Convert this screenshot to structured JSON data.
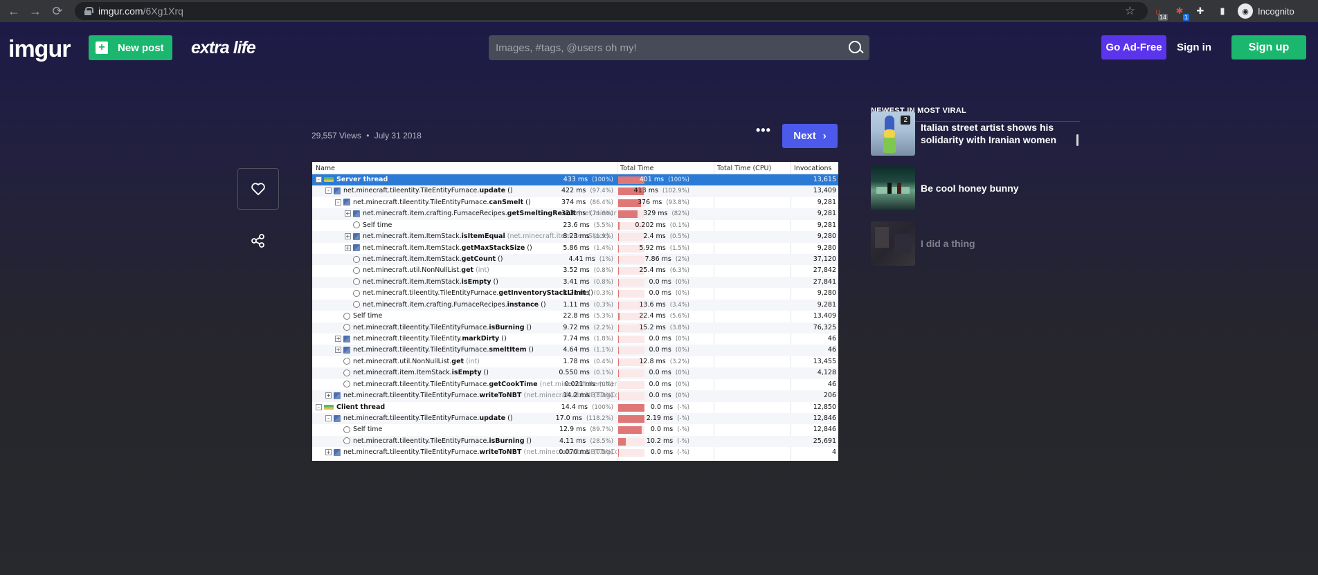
{
  "browser": {
    "url_host": "imgur.com",
    "url_path": "/6Xg1Xrq",
    "ext1_badge": "14",
    "ext2_badge": "1",
    "incognito_label": "Incognito"
  },
  "header": {
    "logo": "imgur",
    "new_post": "New post",
    "extra_life": "extra life",
    "search_placeholder": "Images, #tags, @users oh my!",
    "go_ad_free": "Go Ad-Free",
    "sign_in": "Sign in",
    "sign_up": "Sign up"
  },
  "post": {
    "views": "29,557 Views",
    "separator": "•",
    "date": "July 31 2018",
    "more": "•••",
    "next": "Next"
  },
  "profiler": {
    "headers": [
      "Name",
      "Total Time",
      "Total Time (CPU)",
      "Invocations"
    ],
    "rows": [
      {
        "prefix": "",
        "bold": "Server thread",
        "suffix": "",
        "hint": "",
        "t": "433 ms",
        "tp": "(100%)",
        "cpu": "401 ms",
        "cp": "(100%)",
        "inv": "13,615",
        "bar": 1.0
      },
      {
        "prefix": "net.minecraft.tileentity.TileEntityFurnace.",
        "bold": "update",
        "suffix": " ()",
        "hint": "",
        "t": "422 ms",
        "tp": "(97.4%)",
        "cpu": "413 ms",
        "cp": "(102.9%)",
        "inv": "13,409",
        "bar": 0.974
      },
      {
        "prefix": "net.minecraft.tileentity.TileEntityFurnace.",
        "bold": "canSmelt",
        "suffix": " ()",
        "hint": "",
        "t": "374 ms",
        "tp": "(86.4%)",
        "cpu": "376 ms",
        "cp": "(93.8%)",
        "inv": "9,281",
        "bar": 0.864
      },
      {
        "prefix": "net.minecraft.item.crafting.FurnaceRecipes.",
        "bold": "getSmeltingResult",
        "suffix": " ",
        "hint": "(net.minecra",
        "t": "323 ms",
        "tp": "(74.6%)",
        "cpu": "329 ms",
        "cp": "(82%)",
        "inv": "9,281",
        "bar": 0.746
      },
      {
        "prefix": "Self time",
        "bold": "",
        "suffix": "",
        "hint": "",
        "t": "23.6 ms",
        "tp": "(5.5%)",
        "cpu": "0.202 ms",
        "cp": "(0.1%)",
        "inv": "9,281",
        "bar": 0.055
      },
      {
        "prefix": "net.minecraft.item.ItemStack.",
        "bold": "isItemEqual",
        "suffix": " ",
        "hint": "(net.minecraft.item.ItemStack)",
        "t": "8.23 ms",
        "tp": "(1.9%)",
        "cpu": "2.4 ms",
        "cp": "(0.5%)",
        "inv": "9,280",
        "bar": 0.019
      },
      {
        "prefix": "net.minecraft.item.ItemStack.",
        "bold": "getMaxStackSize",
        "suffix": " ()",
        "hint": "",
        "t": "5.86 ms",
        "tp": "(1.4%)",
        "cpu": "5.92 ms",
        "cp": "(1.5%)",
        "inv": "9,280",
        "bar": 0.014
      },
      {
        "prefix": "net.minecraft.item.ItemStack.",
        "bold": "getCount",
        "suffix": " ()",
        "hint": "",
        "t": "4.41 ms",
        "tp": "(1%)",
        "cpu": "7.86 ms",
        "cp": "(2%)",
        "inv": "37,120",
        "bar": 0.01
      },
      {
        "prefix": "net.minecraft.util.NonNullList.",
        "bold": "get",
        "suffix": " ",
        "hint": "(int)",
        "t": "3.52 ms",
        "tp": "(0.8%)",
        "cpu": "25.4 ms",
        "cp": "(6.3%)",
        "inv": "27,842",
        "bar": 0.008
      },
      {
        "prefix": "net.minecraft.item.ItemStack.",
        "bold": "isEmpty",
        "suffix": " ()",
        "hint": "",
        "t": "3.41 ms",
        "tp": "(0.8%)",
        "cpu": "0.0 ms",
        "cp": "(0%)",
        "inv": "27,841",
        "bar": 0.008
      },
      {
        "prefix": "net.minecraft.tileentity.TileEntityFurnace.",
        "bold": "getInventoryStackLimit",
        "suffix": " ()",
        "hint": "",
        "t": "1.21 ms",
        "tp": "(0.3%)",
        "cpu": "0.0 ms",
        "cp": "(0%)",
        "inv": "9,280",
        "bar": 0.003
      },
      {
        "prefix": "net.minecraft.item.crafting.FurnaceRecipes.",
        "bold": "instance",
        "suffix": " ()",
        "hint": "",
        "t": "1.11 ms",
        "tp": "(0.3%)",
        "cpu": "13.6 ms",
        "cp": "(3.4%)",
        "inv": "9,281",
        "bar": 0.003
      },
      {
        "prefix": "Self time",
        "bold": "",
        "suffix": "",
        "hint": "",
        "t": "22.8 ms",
        "tp": "(5.3%)",
        "cpu": "22.4 ms",
        "cp": "(5.6%)",
        "inv": "13,409",
        "bar": 0.053
      },
      {
        "prefix": "net.minecraft.tileentity.TileEntityFurnace.",
        "bold": "isBurning",
        "suffix": " ()",
        "hint": "",
        "t": "9.72 ms",
        "tp": "(2.2%)",
        "cpu": "15.2 ms",
        "cp": "(3.8%)",
        "inv": "76,325",
        "bar": 0.022
      },
      {
        "prefix": "net.minecraft.tileentity.TileEntity.",
        "bold": "markDirty",
        "suffix": " ()",
        "hint": "",
        "t": "7.74 ms",
        "tp": "(1.8%)",
        "cpu": "0.0 ms",
        "cp": "(0%)",
        "inv": "46",
        "bar": 0.018
      },
      {
        "prefix": "net.minecraft.tileentity.TileEntityFurnace.",
        "bold": "smeltItem",
        "suffix": " ()",
        "hint": "",
        "t": "4.64 ms",
        "tp": "(1.1%)",
        "cpu": "0.0 ms",
        "cp": "(0%)",
        "inv": "46",
        "bar": 0.011
      },
      {
        "prefix": "net.minecraft.util.NonNullList.",
        "bold": "get",
        "suffix": " ",
        "hint": "(int)",
        "t": "1.78 ms",
        "tp": "(0.4%)",
        "cpu": "12.8 ms",
        "cp": "(3.2%)",
        "inv": "13,455",
        "bar": 0.004
      },
      {
        "prefix": "net.minecraft.item.ItemStack.",
        "bold": "isEmpty",
        "suffix": " ()",
        "hint": "",
        "t": "0.550 ms",
        "tp": "(0.1%)",
        "cpu": "0.0 ms",
        "cp": "(0%)",
        "inv": "4,128",
        "bar": 0.001
      },
      {
        "prefix": "net.minecraft.tileentity.TileEntityFurnace.",
        "bold": "getCookTime",
        "suffix": " ",
        "hint": "(net.minecraft.item.ItemS",
        "t": "0.021 ms",
        "tp": "(0%)",
        "cpu": "0.0 ms",
        "cp": "(0%)",
        "inv": "46",
        "bar": 0.0
      },
      {
        "prefix": "net.minecraft.tileentity.TileEntityFurnace.",
        "bold": "writeToNBT",
        "suffix": " ",
        "hint": "(net.minecraft.nbt.NBTTagCom",
        "t": "14.2 ms",
        "tp": "(3.3%)",
        "cpu": "0.0 ms",
        "cp": "(0%)",
        "inv": "206",
        "bar": 0.033
      },
      {
        "prefix": "",
        "bold": "Client thread",
        "suffix": "",
        "hint": "",
        "t": "14.4 ms",
        "tp": "(100%)",
        "cpu": "0.0 ms",
        "cp": "(-%)",
        "inv": "12,850",
        "bar": 1.0
      },
      {
        "prefix": "net.minecraft.tileentity.TileEntityFurnace.",
        "bold": "update",
        "suffix": " ()",
        "hint": "",
        "t": "17.0 ms",
        "tp": "(118.2%)",
        "cpu": "2.19 ms",
        "cp": "(-%)",
        "inv": "12,846",
        "bar": 1.0
      },
      {
        "prefix": "Self time",
        "bold": "",
        "suffix": "",
        "hint": "",
        "t": "12.9 ms",
        "tp": "(89.7%)",
        "cpu": "0.0 ms",
        "cp": "(-%)",
        "inv": "12,846",
        "bar": 0.897
      },
      {
        "prefix": "net.minecraft.tileentity.TileEntityFurnace.",
        "bold": "isBurning",
        "suffix": " ()",
        "hint": "",
        "t": "4.11 ms",
        "tp": "(28.5%)",
        "cpu": "10.2 ms",
        "cp": "(-%)",
        "inv": "25,691",
        "bar": 0.285
      },
      {
        "prefix": "net.minecraft.tileentity.TileEntityFurnace.",
        "bold": "writeToNBT",
        "suffix": " ",
        "hint": "(net.minecraft.nbt.NBTTagCom",
        "t": "0.070 ms",
        "tp": "(0.5%)",
        "cpu": "0.0 ms",
        "cp": "(-%)",
        "inv": "4",
        "bar": 0.005
      }
    ]
  },
  "sidebar": {
    "title": "NEWEST IN MOST VIRAL",
    "items": [
      {
        "title": "Italian street artist shows his solidarity with Iranian women",
        "badge": "2"
      },
      {
        "title": "Be cool honey bunny",
        "badge": ""
      },
      {
        "title": "I did a thing",
        "badge": ""
      }
    ]
  },
  "colors": {
    "green": "#1bb76e",
    "purple": "#5b35ec",
    "blue_next": "#4b5aea",
    "selection": "#2b7bd6",
    "bar": "#e07777"
  }
}
